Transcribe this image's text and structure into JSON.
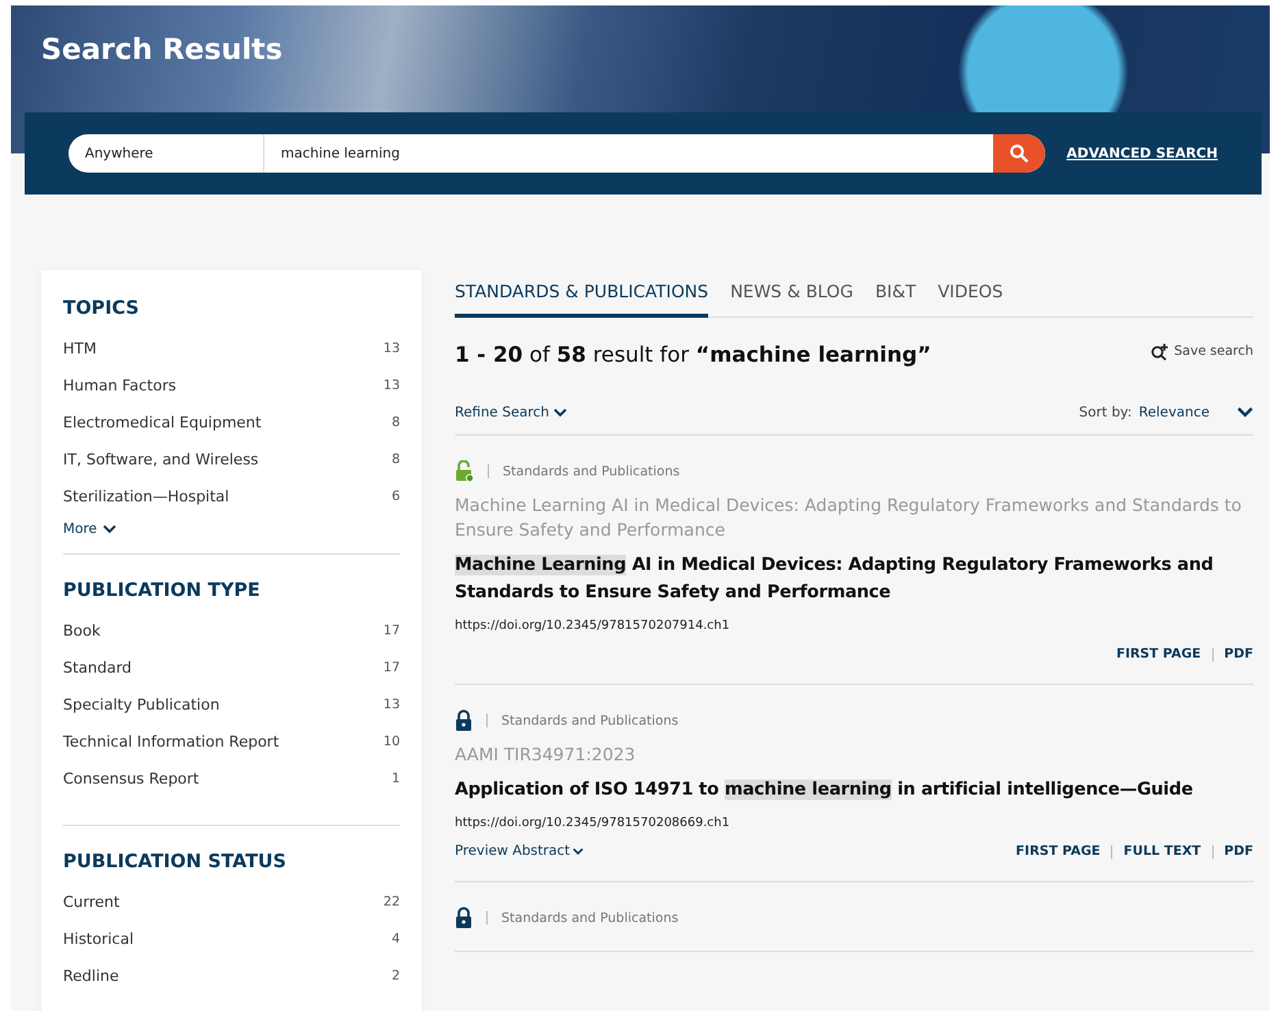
{
  "header": {
    "title": "Search Results"
  },
  "search": {
    "scope": "Anywhere",
    "query": "machine learning",
    "advanced_link": "ADVANCED SEARCH"
  },
  "facets": [
    {
      "title": "TOPICS",
      "items": [
        {
          "label": "HTM",
          "count": "13"
        },
        {
          "label": "Human Factors",
          "count": "13"
        },
        {
          "label": "Electromedical Equipment",
          "count": "8"
        },
        {
          "label": "IT, Software, and Wireless",
          "count": "8"
        },
        {
          "label": "Sterilization—Hospital",
          "count": "6"
        }
      ],
      "more": "More"
    },
    {
      "title": "PUBLICATION TYPE",
      "items": [
        {
          "label": "Book",
          "count": "17"
        },
        {
          "label": "Standard",
          "count": "17"
        },
        {
          "label": "Specialty Publication",
          "count": "13"
        },
        {
          "label": "Technical Information Report",
          "count": "10"
        },
        {
          "label": "Consensus Report",
          "count": "1"
        }
      ]
    },
    {
      "title": "PUBLICATION STATUS",
      "items": [
        {
          "label": "Current",
          "count": "22"
        },
        {
          "label": "Historical",
          "count": "4"
        },
        {
          "label": "Redline",
          "count": "2"
        }
      ]
    }
  ],
  "tabs": [
    {
      "label": "STANDARDS & PUBLICATIONS",
      "selected": true
    },
    {
      "label": "NEWS & BLOG",
      "selected": false
    },
    {
      "label": "BI&T",
      "selected": false
    },
    {
      "label": "VIDEOS",
      "selected": false
    }
  ],
  "summary": "**1 - 20** of **58** result for **“machine learning”**",
  "save_search": "Save search",
  "refine": "Refine Search",
  "sort": {
    "label": "Sort by:",
    "value": "Relevance"
  },
  "results": [
    {
      "kind": "open",
      "category": "Standards and Publications",
      "subtitle": "Machine Learning AI in Medical Devices: Adapting Regulatory Frameworks and Standards to Ensure Safety and Performance",
      "title_parts": [
        {
          "text": "Machine ",
          "highlight": true
        },
        {
          "text": "Learning",
          "highlight": true
        },
        {
          "text": " AI in Medical Devices: Adapting Regulatory Frameworks and Standards to Ensure Safety and Performance",
          "highlight": false
        }
      ],
      "doi": "https://doi.org/10.2345/9781570207914.ch1",
      "actions": [
        "FIRST PAGE",
        "PDF"
      ]
    },
    {
      "kind": "locked",
      "category": "Standards and Publications",
      "subtitle": "AAMI TIR34971:2023",
      "title_parts": [
        {
          "text": "Application of ISO 14971 to ",
          "highlight": false
        },
        {
          "text": "machine ",
          "highlight": true
        },
        {
          "text": "learning",
          "highlight": true
        },
        {
          "text": " in artificial intelligence—Guide",
          "highlight": false
        }
      ],
      "doi": "https://doi.org/10.2345/9781570208669.ch1",
      "preview": "Preview Abstract",
      "actions": [
        "FIRST PAGE",
        "FULL TEXT",
        "PDF"
      ]
    },
    {
      "kind": "locked",
      "category": "Standards and Publications"
    }
  ]
}
